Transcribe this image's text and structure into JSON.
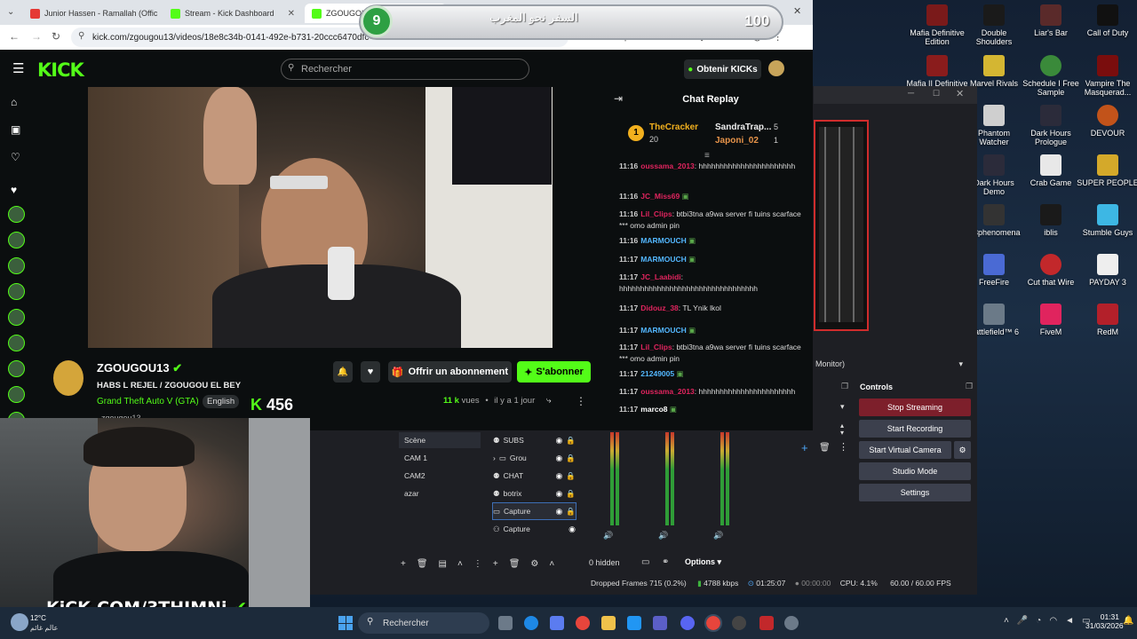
{
  "browser": {
    "tabs": [
      {
        "label": "Junior Hassen - Ramallah (Offic",
        "color": "#e53935"
      },
      {
        "label": "Stream - Kick Dashboard",
        "color": "#53fc18"
      },
      {
        "label": "ZGOUGOU1",
        "color": "#53fc18"
      }
    ],
    "url": "kick.com/zgougou13/videos/18e8c34b-0141-492e-b731-20ccc6470dfc"
  },
  "kick": {
    "logo": "KICK",
    "search_placeholder": "Rechercher",
    "obtenir_kicks": "Obtenir KICKs",
    "streamer": "ZGOUGOU13",
    "title": "HABS L REJEL / ZGOUGOU EL BEY",
    "category": "Grand Theft Auto V (GTA)",
    "language": "English",
    "views_count": "11 k",
    "views_label": "vues",
    "time_ago": "il y a 1 jour",
    "offrir": "Offrir un abonnement",
    "sabonner": "S'abonner",
    "kick_count": "456",
    "subtitle_partial": "zgougou13"
  },
  "chat": {
    "title": "Chat Replay",
    "top_gifter_1": {
      "name": "TheCracker",
      "count": "20"
    },
    "top_gifter_2": {
      "name": "SandraTrap...",
      "count": "5"
    },
    "top_gifter_3": {
      "name": "Japoni_02",
      "count": "1"
    },
    "messages": [
      {
        "time": "11:16",
        "user": "oussama_2013",
        "ucolor": "#e0245e",
        "text": "hhhhhhhhhhhhhhhhhhhhhhh"
      },
      {
        "time": "11:16",
        "user": "JC_Miss69",
        "ucolor": "#e0245e",
        "text": ""
      },
      {
        "time": "11:16",
        "user": "Lil_Clips",
        "ucolor": "#e0245e",
        "text": "btbi3tna a9wa server fi tuins scarface *** omo admin pin"
      },
      {
        "time": "11:16",
        "user": "MARMOUCH",
        "ucolor": "#53b7ff",
        "text": ""
      },
      {
        "time": "11:17",
        "user": "MARMOUCH",
        "ucolor": "#53b7ff",
        "text": ""
      },
      {
        "time": "11:17",
        "user": "JC_Laabidi",
        "ucolor": "#e0245e",
        "text": "hhhhhhhhhhhhhhhhhhhhhhhhhhhhhhhhh"
      },
      {
        "time": "11:17",
        "user": "Didouz_38",
        "ucolor": "#e0245e",
        "text": "TL Ynik lkol"
      },
      {
        "time": "11:17",
        "user": "MARMOUCH",
        "ucolor": "#53b7ff",
        "text": ""
      },
      {
        "time": "11:17",
        "user": "Lil_Clips",
        "ucolor": "#e0245e",
        "text": "btbi3tna a9wa server fi tuins scarface *** omo admin pin"
      },
      {
        "time": "11:17",
        "user": "21249005",
        "ucolor": "#53b7ff",
        "text": ""
      },
      {
        "time": "11:17",
        "user": "oussama_2013",
        "ucolor": "#e0245e",
        "text": "hhhhhhhhhhhhhhhhhhhhhhh"
      },
      {
        "time": "11:17",
        "user": "marco8",
        "ucolor": "#ffffff",
        "text": ""
      }
    ]
  },
  "game": {
    "level": "9",
    "text": "السفر نحو المغرب",
    "score": "100"
  },
  "obs": {
    "monitor_label": "Monitor)",
    "controls_title": "Controls",
    "stop_streaming": "Stop Streaming",
    "start_recording": "Start Recording",
    "start_virtual_camera": "Start Virtual Camera",
    "studio_mode": "Studio Mode",
    "settings": "Settings",
    "scenes": [
      "Scène",
      "CAM 1",
      "CAM2",
      "azar"
    ],
    "sources": [
      "SUBS",
      "Grou",
      "CHAT",
      "botrix",
      "Capture",
      "Capture"
    ],
    "hidden": "0 hidden",
    "options": "Options",
    "status": {
      "dropped": "Dropped Frames 715 (0.2%)",
      "kbps": "4788 kbps",
      "stream_time": "01:25:07",
      "rec_time": "00:00:00",
      "cpu": "CPU: 4.1%",
      "fps": "60.00 / 60.00 FPS"
    }
  },
  "webcam": {
    "watermark": "KiCK.COM/3THIMNi"
  },
  "desktop": {
    "icons": [
      "Mafia Definitive Edition",
      "Double Shoulders",
      "Liar's Bar",
      "Call of Duty",
      "Mafia II Definitive",
      "Marvel Rivals",
      "Schedule I Free Sample",
      "Vampire The Masquerad...",
      "Phantom Watcher",
      "Dark Hours Prologue",
      "DEVOUR",
      "Dark Hours Demo",
      "Crab Game",
      "SUPER PEOPLE",
      "is3phenomena",
      "iblis",
      "Stumble Guys",
      "FreeFire",
      "Cut that Wire",
      "PAYDAY 3",
      "Battlefield™ 6",
      "FiveM",
      "RedM"
    ]
  },
  "taskbar": {
    "search": "Rechercher",
    "time": "01:31",
    "date": "31/03/2026",
    "weather_temp": "12°C",
    "weather_text": "عالم غائم"
  }
}
